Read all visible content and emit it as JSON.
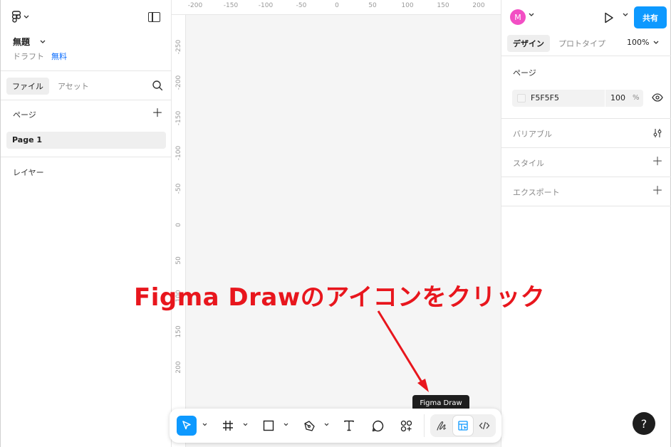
{
  "left_panel": {
    "file_title": "無題",
    "draft_label": "ドラフト",
    "plan_label": "無料",
    "tabs": [
      "ファイル",
      "アセット"
    ],
    "pages_label": "ページ",
    "pages": [
      "Page 1"
    ],
    "layers_label": "レイヤー"
  },
  "canvas": {
    "ruler_h": [
      "-200",
      "-150",
      "-100",
      "-50",
      "0",
      "50",
      "100",
      "150",
      "200"
    ],
    "ruler_v": [
      "-250",
      "-200",
      "-150",
      "-100",
      "-50",
      "0",
      "50",
      "100",
      "150",
      "200"
    ]
  },
  "right_panel": {
    "avatar_initial": "M",
    "share_label": "共有",
    "tabs": [
      "デザイン",
      "プロトタイプ"
    ],
    "zoom": "100%",
    "page_label": "ページ",
    "bg_hex": "F5F5F5",
    "bg_opacity": "100",
    "bg_pct": "%",
    "variables_label": "バリアブル",
    "styles_label": "スタイル",
    "export_label": "エクスポート",
    "help_label": "?"
  },
  "toolbar": {
    "tooltip": "Figma Draw"
  },
  "annotation": {
    "text": "Figma Drawのアイコンをクリック",
    "color": "#e8161d"
  },
  "colors": {
    "accent": "#0d99ff",
    "avatar": "#f24ec4",
    "canvas_bg": "#f5f5f5"
  },
  "icons": [
    "figma-logo-icon",
    "panel-toggle-icon",
    "search-icon",
    "plus-icon",
    "play-icon",
    "eye-icon",
    "tune-icon",
    "move-icon",
    "frame-icon",
    "rectangle-icon",
    "pen-icon",
    "text-icon",
    "comment-icon",
    "actions-icon",
    "draw-icon",
    "design-mode-icon",
    "dev-mode-icon"
  ]
}
